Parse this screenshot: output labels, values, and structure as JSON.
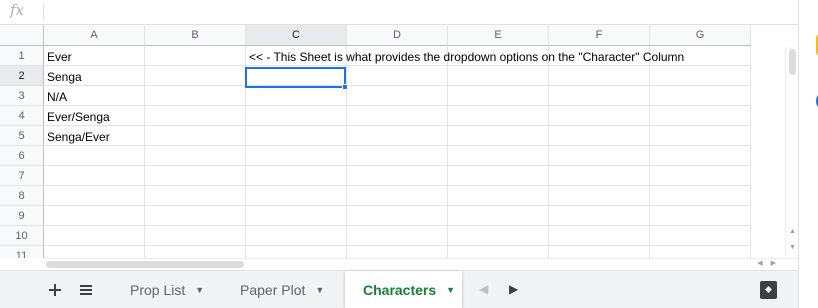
{
  "formula_bar": {
    "label": "fx",
    "value": ""
  },
  "columns": [
    "A",
    "B",
    "C",
    "D",
    "E",
    "F",
    "G"
  ],
  "rows": [
    "1",
    "2",
    "3",
    "4",
    "5",
    "6",
    "7",
    "8",
    "9",
    "10",
    "11"
  ],
  "active_cell": "C2",
  "cells": {
    "A1": "Ever",
    "A2": "Senga",
    "A3": "N/A",
    "A4": "Ever/Senga",
    "A5": "Senga/Ever",
    "C1": "<< - This Sheet is what provides the dropdown options on the \"Character\" Column"
  },
  "tabs": [
    {
      "label": "Prop List",
      "active": false
    },
    {
      "label": "Paper Plot",
      "active": false
    },
    {
      "label": "Characters",
      "active": true
    }
  ],
  "toolbar": {
    "add_sheet_icon": "plus-icon",
    "all_sheets_icon": "list-icon"
  },
  "colors": {
    "accent": "#1a73e8",
    "active_tab": "#188038"
  }
}
